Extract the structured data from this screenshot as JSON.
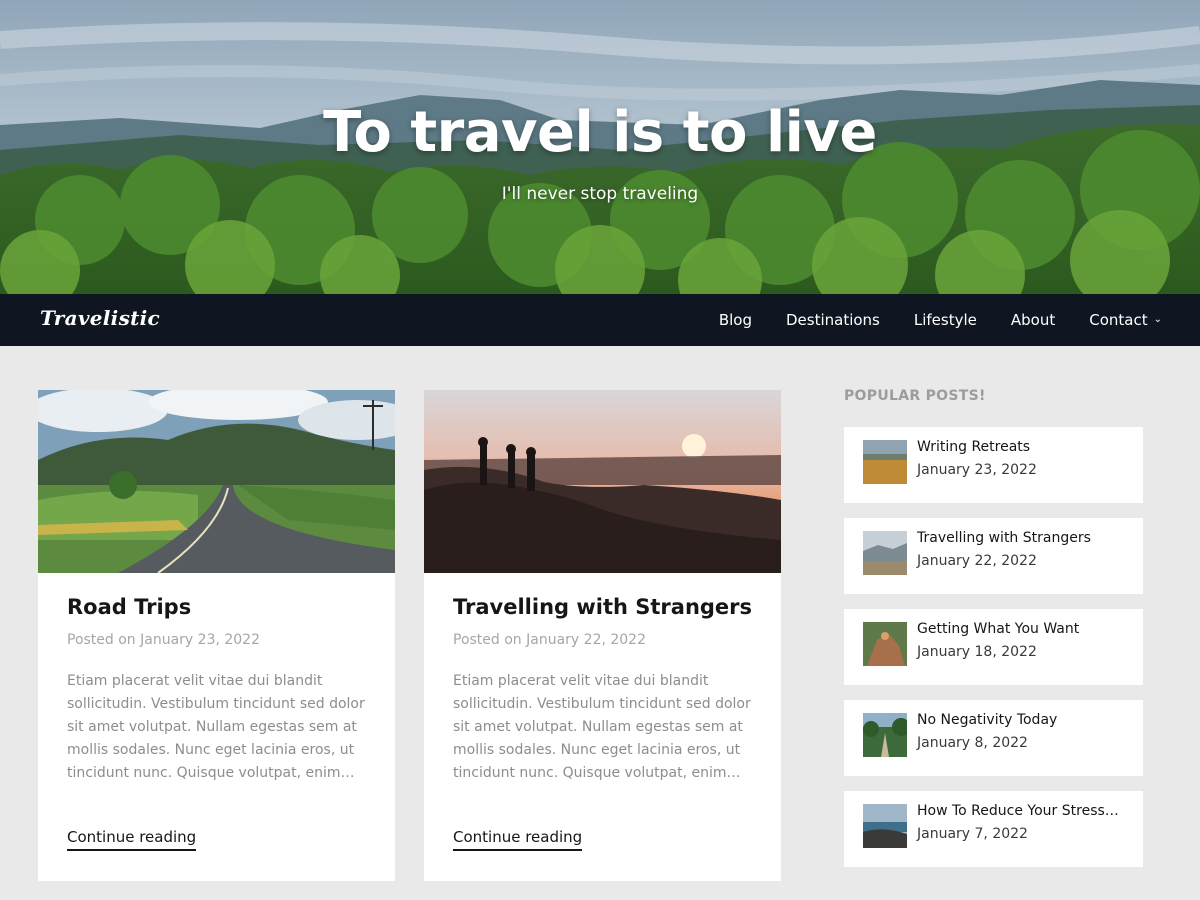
{
  "hero": {
    "title": "To travel is to live",
    "subtitle": "I'll never stop traveling"
  },
  "nav": {
    "logo": "Travelistic",
    "items": [
      {
        "label": "Blog"
      },
      {
        "label": "Destinations"
      },
      {
        "label": "Lifestyle"
      },
      {
        "label": "About"
      },
      {
        "label": "Contact",
        "has_dropdown": true,
        "chevron": "⌄"
      }
    ]
  },
  "posts": [
    {
      "title": "Road Trips",
      "date": "Posted on January 23, 2022",
      "excerpt": "Etiam placerat velit vitae dui blandit sollicitudin. Vestibulum tincidunt sed dolor sit amet volutpat. Nullam egestas sem at mollis sodales. Nunc eget lacinia eros, ut tincidunt nunc. Quisque volutpat, enim…",
      "more": "Continue reading",
      "image": "road-landscape"
    },
    {
      "title": "Travelling with Strangers",
      "date": "Posted on January 22, 2022",
      "excerpt": "Etiam placerat velit vitae dui blandit sollicitudin. Vestibulum tincidunt sed dolor sit amet volutpat. Nullam egestas sem at mollis sodales. Nunc eget lacinia eros, ut tincidunt nunc. Quisque volutpat, enim…",
      "more": "Continue reading",
      "image": "sunset-hikers"
    }
  ],
  "sidebar": {
    "title": "POPULAR POSTS!",
    "items": [
      {
        "title": "Writing Retreats",
        "date": "January 23, 2022"
      },
      {
        "title": "Travelling with Strangers",
        "date": "January 22, 2022"
      },
      {
        "title": "Getting What You Want",
        "date": "January 18, 2022"
      },
      {
        "title": "No Negativity Today",
        "date": "January 8, 2022"
      },
      {
        "title": "How To Reduce Your Stress…",
        "date": "January 7, 2022"
      }
    ]
  },
  "colors": {
    "nav_bg": "#0f1521",
    "page_bg": "#e9e9e9",
    "card_bg": "#ffffff",
    "muted_text": "#a6a6a6"
  }
}
